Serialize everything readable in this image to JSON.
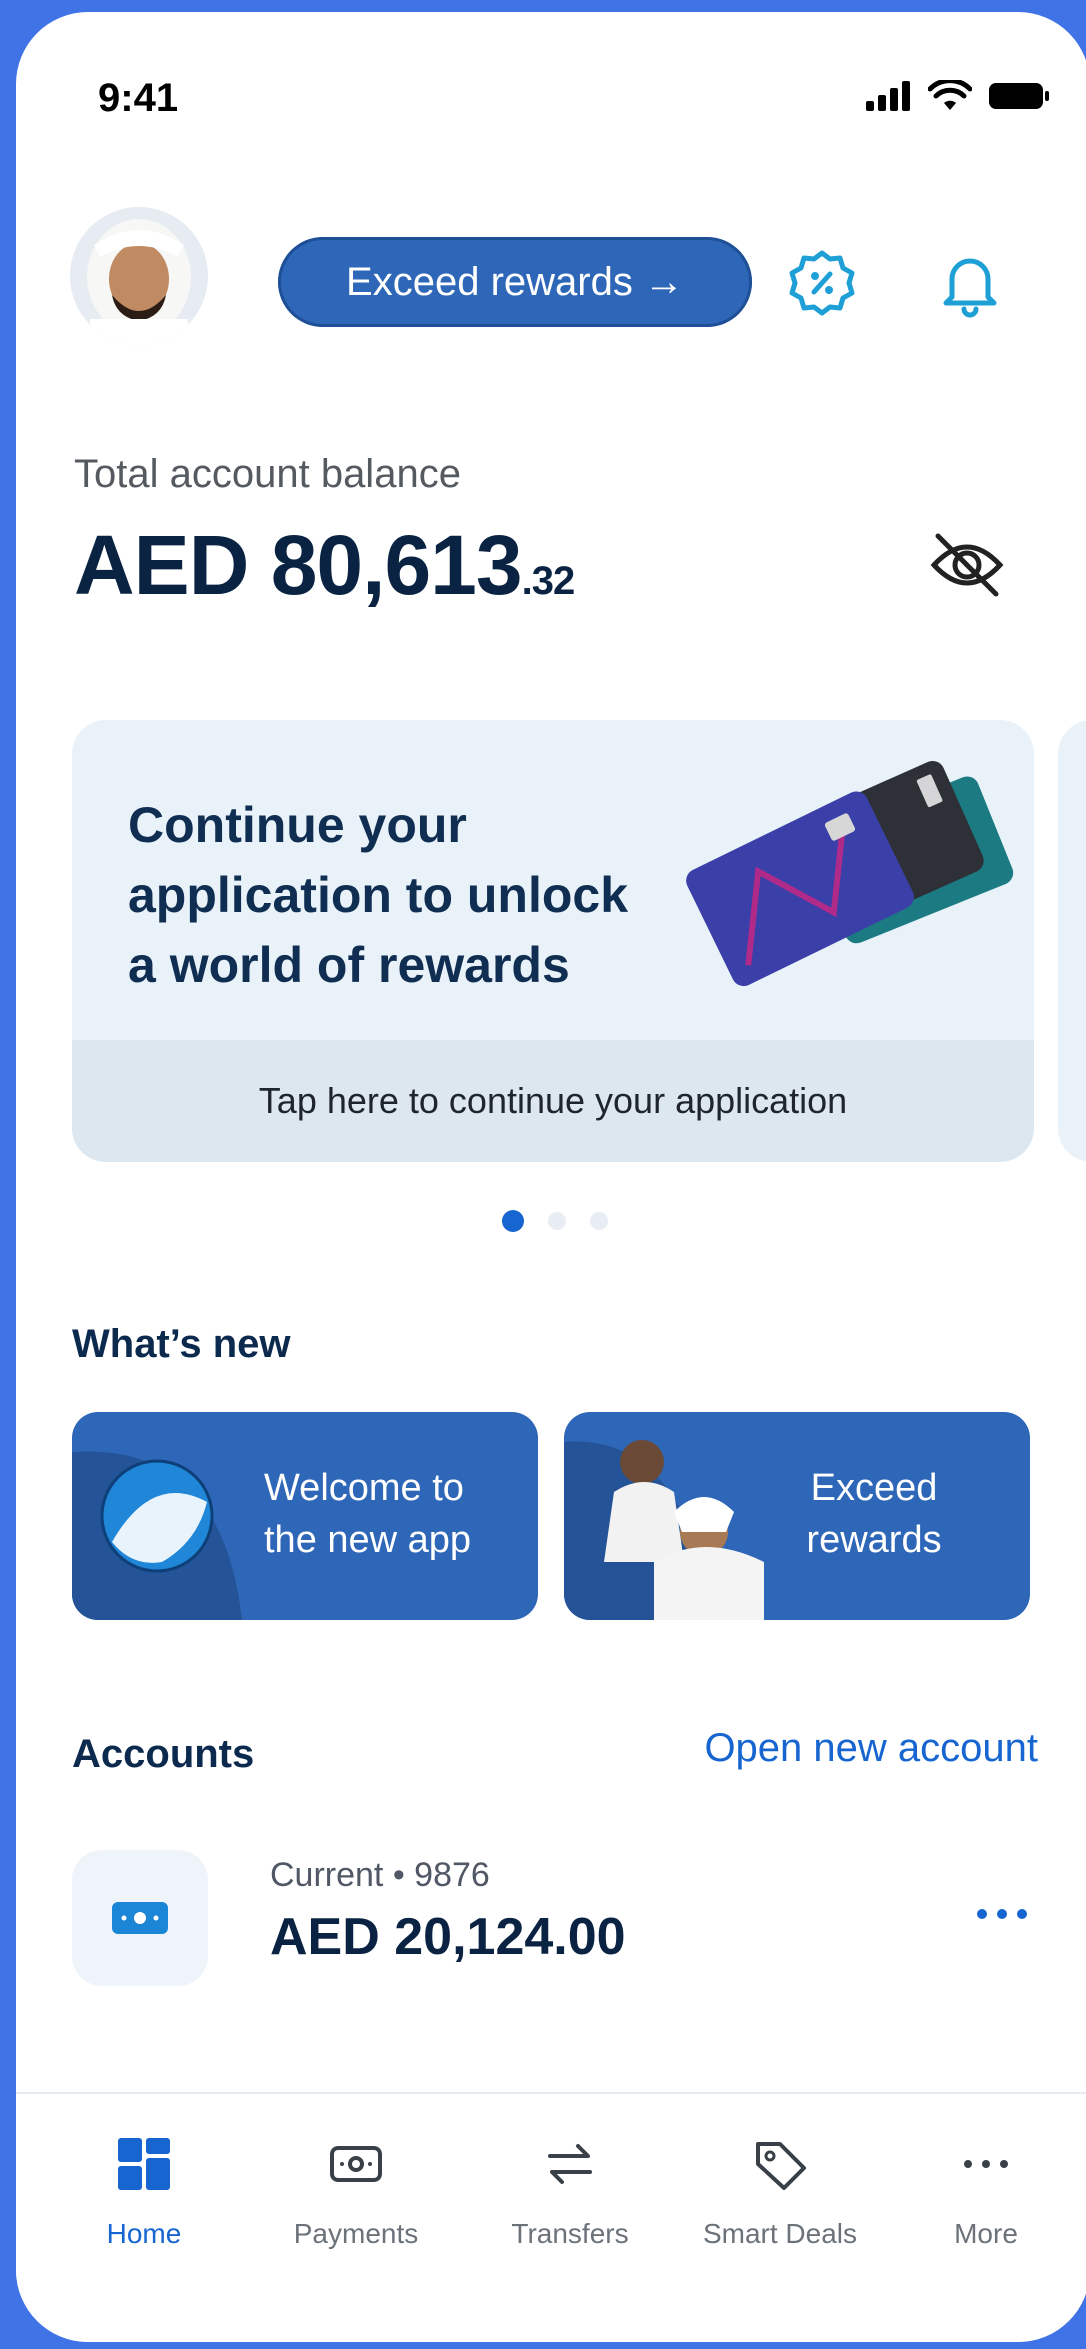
{
  "status_bar": {
    "time": "9:41"
  },
  "header": {
    "rewards_button_label": "Exceed rewards →"
  },
  "balance": {
    "label": "Total account balance",
    "amount_main": "AED 80,613",
    "amount_cents": ".32"
  },
  "promo_card": {
    "title_line_1": "Continue your",
    "title_line_2": "application to unlock",
    "title_line_3": "a world of rewards",
    "footer_text": "Tap here to continue your application"
  },
  "carousel": {
    "pages": 3,
    "active_index": 0
  },
  "whats_new": {
    "title": "What’s new",
    "tiles": [
      {
        "line_1": "Welcome to",
        "line_2": "the new app"
      },
      {
        "line_1": "Exceed",
        "line_2": "rewards"
      }
    ]
  },
  "accounts": {
    "title": "Accounts",
    "open_new_label": "Open new account",
    "items": [
      {
        "subtitle": "Current • 9876",
        "amount": "AED 20,124.00"
      }
    ]
  },
  "tab_bar": {
    "tabs": [
      {
        "label": "Home",
        "icon": "home-icon"
      },
      {
        "label": "Payments",
        "icon": "payments-icon"
      },
      {
        "label": "Transfers",
        "icon": "transfers-icon"
      },
      {
        "label": "Smart Deals",
        "icon": "smart-deals-icon"
      },
      {
        "label": "More",
        "icon": "more-icon"
      }
    ],
    "active_index": 0
  },
  "colors": {
    "frame_background": "#3f73e6",
    "primary": "#2f67b8",
    "link": "#1665d0",
    "text_dark": "#0a2342"
  }
}
